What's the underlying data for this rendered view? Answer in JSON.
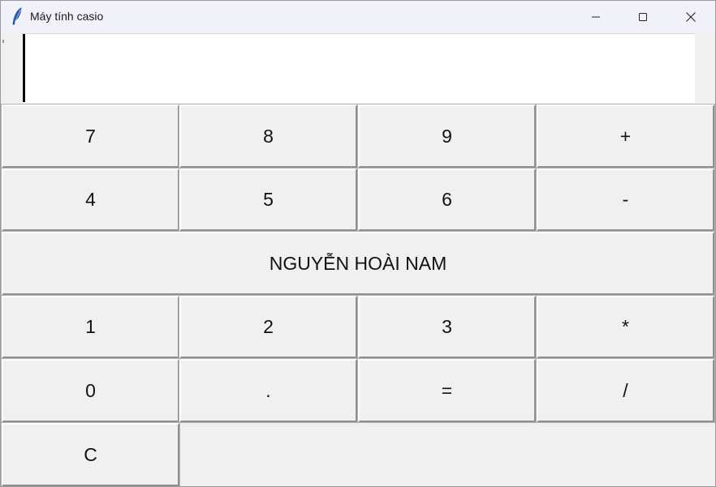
{
  "window": {
    "title": "Máy tính casio",
    "controls": {
      "minimize": "minimize-icon",
      "maximize": "maximize-icon",
      "close": "close-icon"
    }
  },
  "display": {
    "value": ""
  },
  "keypad": {
    "row1": [
      "7",
      "8",
      "9",
      "+"
    ],
    "row2": [
      "4",
      "5",
      "6",
      "-"
    ],
    "banner": "NGUYỄN HOÀI NAM",
    "row4": [
      "1",
      "2",
      "3",
      "*"
    ],
    "row5": [
      "0",
      ".",
      "=",
      "/"
    ],
    "row6": [
      "C"
    ]
  },
  "colors": {
    "titlebar": "#f0f1f9",
    "window_bg": "#f0f0f0",
    "display_bg": "#ffffff"
  }
}
